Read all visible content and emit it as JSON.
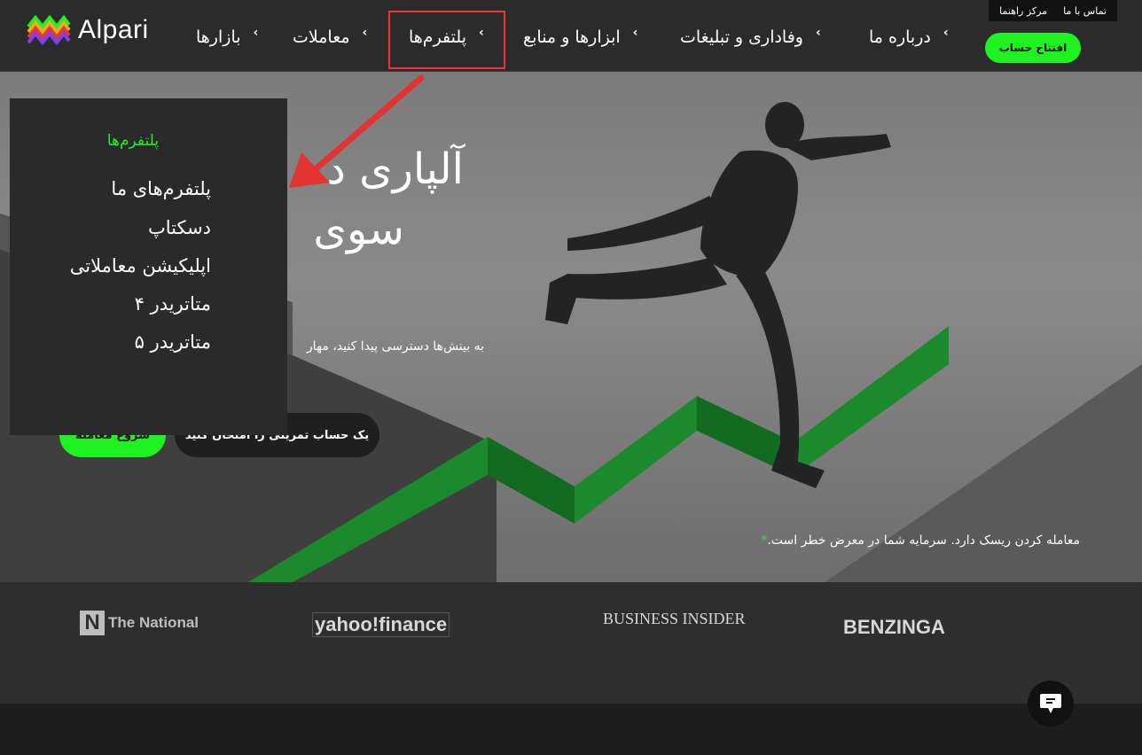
{
  "header": {
    "logo_text": "Alpari",
    "topbar": {
      "contact": "تماس با ما",
      "help": "مرکز راهنما"
    },
    "nav": [
      {
        "label": "بازارها"
      },
      {
        "label": "معاملات"
      },
      {
        "label": "پلتفرم‌ها"
      },
      {
        "label": "ابزارها و منابع"
      },
      {
        "label": "وفاداری و تبلیغات"
      },
      {
        "label": "درباره ما"
      }
    ],
    "open_account": "افتتاح حساب"
  },
  "hero": {
    "title_line1": "آلپاری د",
    "title_line2": "سوی",
    "subtitle": "به بینش‌ها دسترسی پیدا کنید، مهار",
    "risk_notice": "معامله کردن ریسک دارد. سرمایه شما در معرض خطر است.",
    "risk_star": "*",
    "demo_button": "یک حساب تمرینی را امتحان کنید",
    "start_button": "شروع معامله"
  },
  "dropdown": {
    "heading": "پلتفرم‌ها",
    "items": [
      "پلتفرم‌های ما",
      "دسکتاپ",
      "اپلیکیشن معاملاتی",
      "متاتریدر ۴",
      "متاتریدر ۵"
    ]
  },
  "press": {
    "logos": [
      "The National",
      "yahoo!finance",
      "BUSINESS INSIDER",
      "BENZINGA"
    ]
  },
  "colors": {
    "accent": "#1ef221",
    "annotation": "#e33333",
    "header_bg": "#2b2b2b"
  }
}
